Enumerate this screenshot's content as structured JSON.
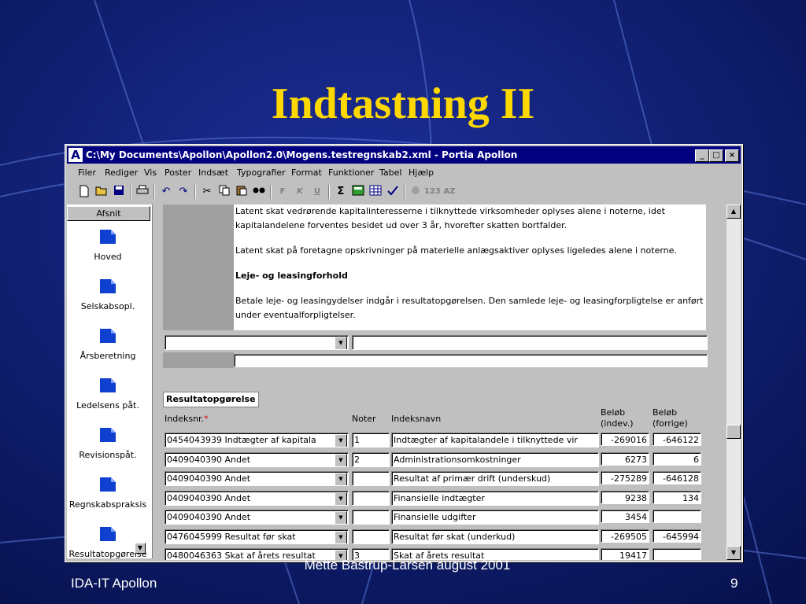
{
  "slide": {
    "title": "Indtastning II",
    "footer_left": "IDA-IT Apollon",
    "footer_center": "Mette Bastrup-Larsen august 2001",
    "footer_right": "9"
  },
  "window": {
    "title": "C:\\My Documents\\Apollon\\Apollon2.0\\Mogens.testregnskab2.xml - Portia Apollon",
    "app_icon": "A",
    "minimize_glyph": "_",
    "maximize_glyph": "□",
    "close_glyph": "×"
  },
  "menu": [
    "Filer",
    "Rediger",
    "Vis",
    "Poster",
    "Indsæt",
    "Typografier",
    "Format",
    "Funktioner",
    "Tabel",
    "Hjælp"
  ],
  "toolbar": {
    "icons": [
      "new-icon",
      "open-icon",
      "save-icon",
      "print-icon",
      "undo-icon",
      "redo-icon",
      "cut-icon",
      "copy-icon",
      "paste-icon",
      "find-icon",
      "bold-icon",
      "italic-icon",
      "underline-icon",
      "sum-icon",
      "calc-icon",
      "table-icon",
      "spellcheck-icon",
      "sort-icon",
      "numeric-icon",
      "alpha-icon"
    ],
    "bold": "F",
    "italic": "K",
    "underline": "U",
    "sum": "Σ",
    "numeric": "123",
    "alpha": "AZ"
  },
  "sidebar": {
    "header": "Afsnit",
    "items": [
      "Hoved",
      "Selskabsopl.",
      "Årsberetning",
      "Ledelsens påt.",
      "Revisionspåt.",
      "Regnskabspraksis",
      "Resultatopgørelse"
    ]
  },
  "document": {
    "para1": "Latent skat vedrørende kapitalinteresserne i tilknyttede virksomheder oplyses alene i noterne, idet kapitalandelene forventes besidet ud over 3 år, hvorefter skatten bortfalder.",
    "para2": "Latent skat på foretagne opskrivninger på materielle anlægsaktiver oplyses ligeledes alene i noterne.",
    "heading": "Leje- og leasingforhold",
    "para3": "Betale leje- og leasingydelser indgår i resultatopgørelsen. Den samlede leje- og leasingforpligtelse er anført under eventualforpligtelser."
  },
  "grid": {
    "title": "Resultatopgørelse",
    "col_index": "Indeksnr.",
    "required_mark": "*",
    "col_noter": "Noter",
    "col_name": "Indeksnavn",
    "col_amount1_l1": "Beløb",
    "col_amount1_l2": "(indev.)",
    "col_amount2_l1": "Beløb",
    "col_amount2_l2": "(forrige)",
    "rows": [
      {
        "index": "0454043939  Indtægter af kapitala",
        "note": "1",
        "name": "Indtægter af kapitalandele i tilknyttede vir",
        "cur": "-269016",
        "prev": "-646122"
      },
      {
        "index": "0409040390  Andet",
        "note": "2",
        "name": "Administrationsomkostninger",
        "cur": "6273",
        "prev": "6"
      },
      {
        "index": "0409040390  Andet",
        "note": "",
        "name": "Resultat af primær drift (underskud)",
        "cur": "-275289",
        "prev": "-646128"
      },
      {
        "index": "0409040390  Andet",
        "note": "",
        "name": "Finansielle indtægter",
        "cur": "9238",
        "prev": "134"
      },
      {
        "index": "0409040390  Andet",
        "note": "",
        "name": "Finansielle udgifter",
        "cur": "3454",
        "prev": ""
      },
      {
        "index": "0476045999  Resultat før skat",
        "note": "",
        "name": "Resultat før skat (underkud)",
        "cur": "-269505",
        "prev": "-645994"
      },
      {
        "index": "0480046363  Skat af årets resultat",
        "note": "3",
        "name": "Skat af årets resultat",
        "cur": "19417",
        "prev": ""
      }
    ]
  }
}
